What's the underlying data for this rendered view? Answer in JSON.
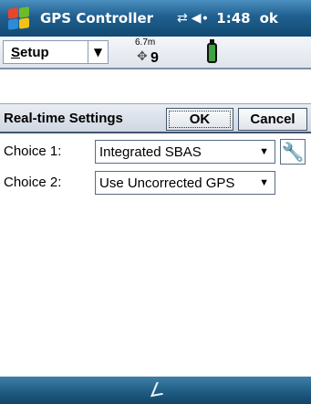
{
  "titlebar": {
    "app_title": "GPS Controller",
    "connectivity_icon": "network-sync-icon",
    "volume_icon": "speaker-icon",
    "time": "1:48",
    "ok_label": "ok"
  },
  "toolbar": {
    "menu_label": "Setup",
    "accuracy": "6.7m",
    "satellite_count": "9",
    "battery_icon": "battery-icon"
  },
  "settings": {
    "title": "Real-time Settings",
    "ok_button": "OK",
    "cancel_button": "Cancel",
    "choices": [
      {
        "label": "Choice 1:",
        "value": "Integrated SBAS"
      },
      {
        "label": "Choice 2:",
        "value": "Use Uncorrected GPS"
      }
    ]
  },
  "colors": {
    "titlebar": "#1f5f8f",
    "battery_fill": "#3fa33f"
  }
}
